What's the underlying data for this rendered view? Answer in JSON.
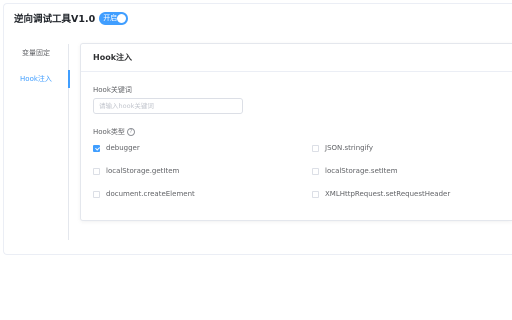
{
  "header": {
    "title": "逆向调试工具V1.0",
    "toggle_label": "开启",
    "toggle_on": true
  },
  "menu": {
    "items": [
      {
        "label": "变量固定",
        "active": false
      },
      {
        "label": "Hook注入",
        "active": true
      }
    ]
  },
  "panel": {
    "title": "Hook注入",
    "keyword_label": "Hook关键词",
    "keyword_placeholder": "请输入hook关键词",
    "keyword_value": "",
    "type_label": "Hook类型",
    "type_help_icon": "question-circle-icon",
    "options": [
      {
        "label": "debugger",
        "checked": true
      },
      {
        "label": "JSON.stringify",
        "checked": false
      },
      {
        "label": "localStorage.getItem",
        "checked": false
      },
      {
        "label": "localStorage.setItem",
        "checked": false
      },
      {
        "label": "document.createElement",
        "checked": false
      },
      {
        "label": "XMLHttpRequest.setRequestHeader",
        "checked": false
      }
    ]
  },
  "colors": {
    "accent": "#409eff",
    "border": "#dcdfe6",
    "text": "#606266"
  }
}
